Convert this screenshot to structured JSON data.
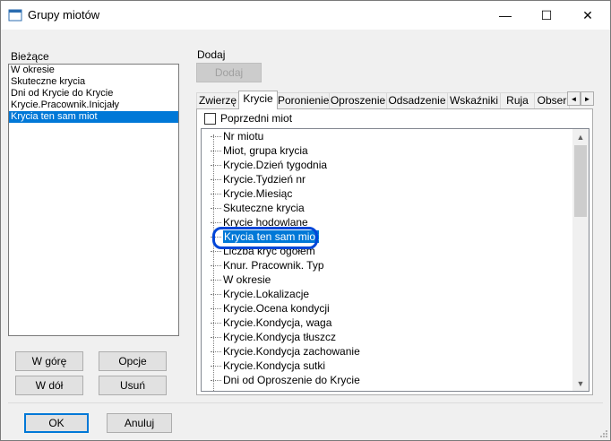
{
  "window": {
    "title": "Grupy miotów",
    "minimize_glyph": "—",
    "maximize_glyph": "☐",
    "close_glyph": "✕"
  },
  "current": {
    "label": "Bieżące",
    "items": [
      "W okresie",
      "Skuteczne krycia",
      "Dni od Krycie do Krycie",
      "Krycie.Pracownik.Inicjały",
      "Krycia ten sam miot"
    ],
    "selected_index": 4
  },
  "left_buttons": {
    "up": "W górę",
    "options": "Opcje",
    "down": "W dół",
    "remove": "Usuń"
  },
  "add": {
    "label": "Dodaj",
    "button": "Dodaj"
  },
  "tabs": [
    "Zwierzę",
    "Krycie",
    "Poronienie",
    "Oproszenie",
    "Odsadzenie",
    "Wskaźniki",
    "Ruja",
    "Obser"
  ],
  "active_tab": "Krycie",
  "tab_scroll": {
    "left": "◄",
    "right": "►"
  },
  "previous_litter": {
    "label": "Poprzedni miot",
    "checked": false
  },
  "tree_items": [
    "Nr miotu",
    "Miot, grupa krycia",
    "Krycie.Dzień tygodnia",
    "Krycie.Tydzień nr",
    "Krycie.Miesiąc",
    "Skuteczne krycia",
    "Krycie hodowlane",
    "Krycia ten sam miot",
    "Liczba kryć ogółem",
    "Knur. Pracownik. Typ",
    "W okresie",
    "Krycie.Lokalizacje",
    "Krycie.Ocena kondycji",
    "Krycie.Kondycja, waga",
    "Krycie.Kondycja tłuszcz",
    "Krycie.Kondycja zachowanie",
    "Krycie.Kondycja sutki",
    "Dni od Oproszenie do Krycie"
  ],
  "tree_selected_index": 7,
  "scroll_glyphs": {
    "up": "▲",
    "down": "▼"
  },
  "footer": {
    "ok": "OK",
    "cancel": "Anuluj"
  },
  "colors": {
    "selection": "#0078d7",
    "highlight_ring": "#0046d8",
    "window_bg": "#f0f0f0"
  }
}
